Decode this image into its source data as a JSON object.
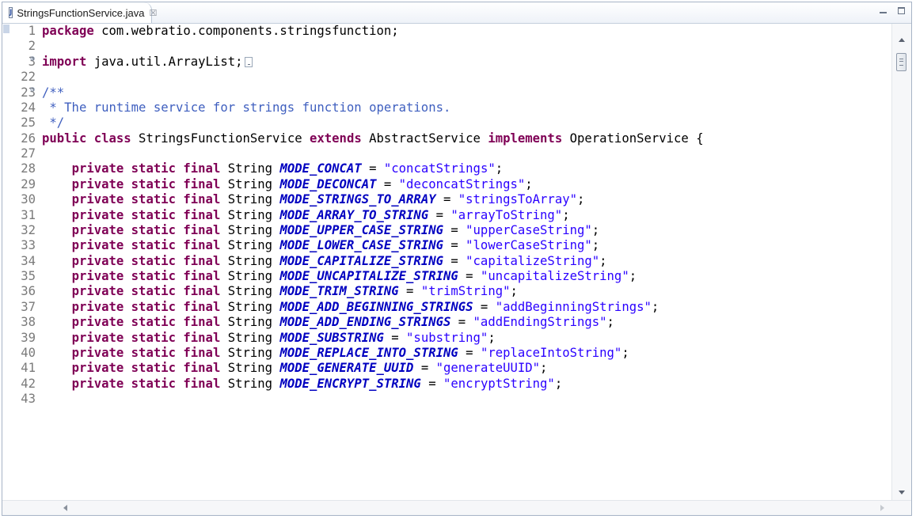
{
  "tab": {
    "title": "StringsFunctionService.java",
    "close_glyph": "☒",
    "icon": "java-file-icon"
  },
  "window_controls": {
    "minimize": "minimize-icon",
    "maximize": "maximize-icon"
  },
  "lines": [
    {
      "num": "1",
      "tokens": [
        {
          "t": "kw",
          "v": "package"
        },
        {
          "t": "pl",
          "v": " com.webratio.components.stringsfunction;"
        }
      ]
    },
    {
      "num": "2",
      "tokens": []
    },
    {
      "num": "3",
      "fold": "⊕",
      "collapsed": true,
      "tokens": [
        {
          "t": "kw",
          "v": "import"
        },
        {
          "t": "pl",
          "v": " java.util.ArrayList;"
        }
      ]
    },
    {
      "num": "22",
      "tokens": []
    },
    {
      "num": "23",
      "fold": "⊖",
      "tokens": [
        {
          "t": "cm",
          "v": "/**"
        }
      ]
    },
    {
      "num": "24",
      "tokens": [
        {
          "t": "cm",
          "v": " * The runtime service for strings function operations."
        }
      ]
    },
    {
      "num": "25",
      "tokens": [
        {
          "t": "cm",
          "v": " */"
        }
      ]
    },
    {
      "num": "26",
      "tokens": [
        {
          "t": "kw",
          "v": "public class"
        },
        {
          "t": "pl",
          "v": " StringsFunctionService "
        },
        {
          "t": "kw",
          "v": "extends"
        },
        {
          "t": "pl",
          "v": " AbstractService "
        },
        {
          "t": "kw",
          "v": "implements"
        },
        {
          "t": "pl",
          "v": " OperationService {"
        }
      ]
    },
    {
      "num": "27",
      "tokens": []
    },
    {
      "num": "28",
      "tokens": [
        {
          "t": "pl",
          "v": "    "
        },
        {
          "t": "kw",
          "v": "private static final"
        },
        {
          "t": "pl",
          "v": " String "
        },
        {
          "t": "fd",
          "v": "MODE_CONCAT"
        },
        {
          "t": "pl",
          "v": " = "
        },
        {
          "t": "st",
          "v": "\"concatStrings\""
        },
        {
          "t": "pl",
          "v": ";"
        }
      ]
    },
    {
      "num": "29",
      "tokens": [
        {
          "t": "pl",
          "v": "    "
        },
        {
          "t": "kw",
          "v": "private static final"
        },
        {
          "t": "pl",
          "v": " String "
        },
        {
          "t": "fd",
          "v": "MODE_DECONCAT"
        },
        {
          "t": "pl",
          "v": " = "
        },
        {
          "t": "st",
          "v": "\"deconcatStrings\""
        },
        {
          "t": "pl",
          "v": ";"
        }
      ]
    },
    {
      "num": "30",
      "tokens": [
        {
          "t": "pl",
          "v": "    "
        },
        {
          "t": "kw",
          "v": "private static final"
        },
        {
          "t": "pl",
          "v": " String "
        },
        {
          "t": "fd",
          "v": "MODE_STRINGS_TO_ARRAY"
        },
        {
          "t": "pl",
          "v": " = "
        },
        {
          "t": "st",
          "v": "\"stringsToArray\""
        },
        {
          "t": "pl",
          "v": ";"
        }
      ]
    },
    {
      "num": "31",
      "tokens": [
        {
          "t": "pl",
          "v": "    "
        },
        {
          "t": "kw",
          "v": "private static final"
        },
        {
          "t": "pl",
          "v": " String "
        },
        {
          "t": "fd",
          "v": "MODE_ARRAY_TO_STRING"
        },
        {
          "t": "pl",
          "v": " = "
        },
        {
          "t": "st",
          "v": "\"arrayToString\""
        },
        {
          "t": "pl",
          "v": ";"
        }
      ]
    },
    {
      "num": "32",
      "tokens": [
        {
          "t": "pl",
          "v": "    "
        },
        {
          "t": "kw",
          "v": "private static final"
        },
        {
          "t": "pl",
          "v": " String "
        },
        {
          "t": "fd",
          "v": "MODE_UPPER_CASE_STRING"
        },
        {
          "t": "pl",
          "v": " = "
        },
        {
          "t": "st",
          "v": "\"upperCaseString\""
        },
        {
          "t": "pl",
          "v": ";"
        }
      ]
    },
    {
      "num": "33",
      "tokens": [
        {
          "t": "pl",
          "v": "    "
        },
        {
          "t": "kw",
          "v": "private static final"
        },
        {
          "t": "pl",
          "v": " String "
        },
        {
          "t": "fd",
          "v": "MODE_LOWER_CASE_STRING"
        },
        {
          "t": "pl",
          "v": " = "
        },
        {
          "t": "st",
          "v": "\"lowerCaseString\""
        },
        {
          "t": "pl",
          "v": ";"
        }
      ]
    },
    {
      "num": "34",
      "tokens": [
        {
          "t": "pl",
          "v": "    "
        },
        {
          "t": "kw",
          "v": "private static final"
        },
        {
          "t": "pl",
          "v": " String "
        },
        {
          "t": "fd",
          "v": "MODE_CAPITALIZE_STRING"
        },
        {
          "t": "pl",
          "v": " = "
        },
        {
          "t": "st",
          "v": "\"capitalizeString\""
        },
        {
          "t": "pl",
          "v": ";"
        }
      ]
    },
    {
      "num": "35",
      "tokens": [
        {
          "t": "pl",
          "v": "    "
        },
        {
          "t": "kw",
          "v": "private static final"
        },
        {
          "t": "pl",
          "v": " String "
        },
        {
          "t": "fd",
          "v": "MODE_UNCAPITALIZE_STRING"
        },
        {
          "t": "pl",
          "v": " = "
        },
        {
          "t": "st",
          "v": "\"uncapitalizeString\""
        },
        {
          "t": "pl",
          "v": ";"
        }
      ]
    },
    {
      "num": "36",
      "tokens": [
        {
          "t": "pl",
          "v": "    "
        },
        {
          "t": "kw",
          "v": "private static final"
        },
        {
          "t": "pl",
          "v": " String "
        },
        {
          "t": "fd",
          "v": "MODE_TRIM_STRING"
        },
        {
          "t": "pl",
          "v": " = "
        },
        {
          "t": "st",
          "v": "\"trimString\""
        },
        {
          "t": "pl",
          "v": ";"
        }
      ]
    },
    {
      "num": "37",
      "tokens": [
        {
          "t": "pl",
          "v": "    "
        },
        {
          "t": "kw",
          "v": "private static final"
        },
        {
          "t": "pl",
          "v": " String "
        },
        {
          "t": "fd",
          "v": "MODE_ADD_BEGINNING_STRINGS"
        },
        {
          "t": "pl",
          "v": " = "
        },
        {
          "t": "st",
          "v": "\"addBeginningStrings\""
        },
        {
          "t": "pl",
          "v": ";"
        }
      ]
    },
    {
      "num": "38",
      "tokens": [
        {
          "t": "pl",
          "v": "    "
        },
        {
          "t": "kw",
          "v": "private static final"
        },
        {
          "t": "pl",
          "v": " String "
        },
        {
          "t": "fd",
          "v": "MODE_ADD_ENDING_STRINGS"
        },
        {
          "t": "pl",
          "v": " = "
        },
        {
          "t": "st",
          "v": "\"addEndingStrings\""
        },
        {
          "t": "pl",
          "v": ";"
        }
      ]
    },
    {
      "num": "39",
      "tokens": [
        {
          "t": "pl",
          "v": "    "
        },
        {
          "t": "kw",
          "v": "private static final"
        },
        {
          "t": "pl",
          "v": " String "
        },
        {
          "t": "fd",
          "v": "MODE_SUBSTRING"
        },
        {
          "t": "pl",
          "v": " = "
        },
        {
          "t": "st",
          "v": "\"substring\""
        },
        {
          "t": "pl",
          "v": ";"
        }
      ]
    },
    {
      "num": "40",
      "tokens": [
        {
          "t": "pl",
          "v": "    "
        },
        {
          "t": "kw",
          "v": "private static final"
        },
        {
          "t": "pl",
          "v": " String "
        },
        {
          "t": "fd",
          "v": "MODE_REPLACE_INTO_STRING"
        },
        {
          "t": "pl",
          "v": " = "
        },
        {
          "t": "st",
          "v": "\"replaceIntoString\""
        },
        {
          "t": "pl",
          "v": ";"
        }
      ]
    },
    {
      "num": "41",
      "tokens": [
        {
          "t": "pl",
          "v": "    "
        },
        {
          "t": "kw",
          "v": "private static final"
        },
        {
          "t": "pl",
          "v": " String "
        },
        {
          "t": "fd",
          "v": "MODE_GENERATE_UUID"
        },
        {
          "t": "pl",
          "v": " = "
        },
        {
          "t": "st",
          "v": "\"generateUUID\""
        },
        {
          "t": "pl",
          "v": ";"
        }
      ]
    },
    {
      "num": "42",
      "tokens": [
        {
          "t": "pl",
          "v": "    "
        },
        {
          "t": "kw",
          "v": "private static final"
        },
        {
          "t": "pl",
          "v": " String "
        },
        {
          "t": "fd",
          "v": "MODE_ENCRYPT_STRING"
        },
        {
          "t": "pl",
          "v": " = "
        },
        {
          "t": "st",
          "v": "\"encryptString\""
        },
        {
          "t": "pl",
          "v": ";"
        }
      ]
    },
    {
      "num": "43",
      "tokens": []
    }
  ]
}
